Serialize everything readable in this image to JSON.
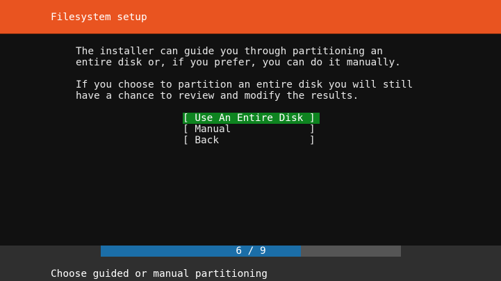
{
  "header": {
    "title": "Filesystem setup"
  },
  "body": {
    "lines": [
      "The installer can guide you through partitioning an",
      "entire disk or, if you prefer, you can do it manually.",
      "If you choose to partition an entire disk you will still",
      "have a chance to review and modify the results."
    ]
  },
  "menu": {
    "items": [
      {
        "label": "[ Use An Entire Disk ]",
        "selected": true
      },
      {
        "label": "[ Manual             ]",
        "selected": false
      },
      {
        "label": "[ Back               ]",
        "selected": false
      }
    ]
  },
  "progress": {
    "label": "6 / 9",
    "current": 6,
    "total": 9
  },
  "footer": {
    "status": "Choose guided or manual partitioning"
  },
  "colors": {
    "header_bg": "#e95420",
    "selected_bg": "#0e8420",
    "progress_fill": "#1b6ea8",
    "progress_track": "#555555",
    "footer_bg": "#2f2f2f",
    "background": "#111111"
  }
}
